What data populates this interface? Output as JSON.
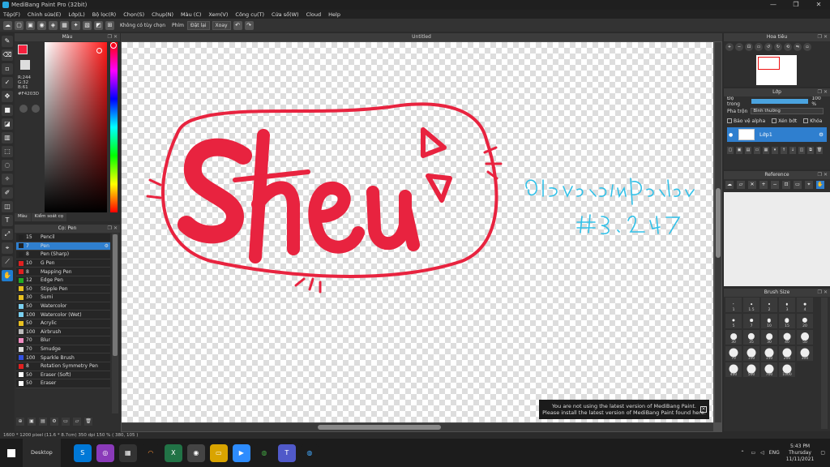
{
  "window": {
    "title": "MediBang Paint Pro (32bit)",
    "min": "—",
    "max": "❐",
    "close": "✕"
  },
  "menu": [
    "Tệp(F)",
    "Chỉnh sửa(E)",
    "Lớp(L)",
    "Bộ lọc(R)",
    "Chọn(S)",
    "Chụp(N)",
    "Màu (C)",
    "Xem(V)",
    "Công cụ(T)",
    "Cửa sổ(W)",
    "Cloud",
    "Help"
  ],
  "toolbar": {
    "aa_label": "Không có tùy chọn",
    "key_label": "Phím",
    "reset_label": "Đặt lại",
    "rotate_label": "Xoay"
  },
  "color_panel": {
    "title": "Màu",
    "r": "R:244",
    "g": "G:32",
    "b": "B:61",
    "hex": "#F4203D",
    "tab1": "Màu",
    "tab2": "Kiểm soát cọ",
    "fg_color": "#f4203d"
  },
  "brush_panel": {
    "title": "Cọ: Pen",
    "items": [
      {
        "size": "15",
        "name": "Pencil",
        "color": "#222222"
      },
      {
        "size": "7",
        "name": "Pen",
        "color": "#222222"
      },
      {
        "size": "8",
        "name": "Pen (Sharp)",
        "color": "#222222"
      },
      {
        "size": "10",
        "name": "G Pen",
        "color": "#e02020"
      },
      {
        "size": "8",
        "name": "Mapping Pen",
        "color": "#e02020"
      },
      {
        "size": "12",
        "name": "Edge Pen",
        "color": "#22aa22"
      },
      {
        "size": "50",
        "name": "Stipple Pen",
        "color": "#e8c020"
      },
      {
        "size": "30",
        "name": "Sumi",
        "color": "#e8c020"
      },
      {
        "size": "50",
        "name": "Watercolor",
        "color": "#7ad0f0"
      },
      {
        "size": "100",
        "name": "Watercolor (Wet)",
        "color": "#7ad0f0"
      },
      {
        "size": "50",
        "name": "Acrylic",
        "color": "#e8c020"
      },
      {
        "size": "100",
        "name": "Airbrush",
        "color": "#bbbbbb"
      },
      {
        "size": "70",
        "name": "Blur",
        "color": "#f08ac0"
      },
      {
        "size": "70",
        "name": "Smudge",
        "color": "#dddddd"
      },
      {
        "size": "100",
        "name": "Sparkle Brush",
        "color": "#3050e0"
      },
      {
        "size": "8",
        "name": "Rotation Symmetry Pen",
        "color": "#e02020"
      },
      {
        "size": "50",
        "name": "Eraser (Soft)",
        "color": "#ffffff"
      },
      {
        "size": "50",
        "name": "Eraser",
        "color": "#ffffff"
      }
    ]
  },
  "document": {
    "tab": "Untitled"
  },
  "notice": {
    "line1": "You are not using the latest version of MediBang Paint.",
    "line2": "Please install the latest version of MediBang Paint found here."
  },
  "status": "1600 * 1200 pixel   (11.6 * 8.7cm)   350 dpi   150 %   ( 380, 105 )",
  "navigator": {
    "title": "Hoa tiêu"
  },
  "layer_panel": {
    "title": "Lớp",
    "opacity_label": "Độ trong",
    "opacity_value": "100 %",
    "opacity": 1.0,
    "blend_label": "Pha trộn",
    "blend_value": "Bình thường",
    "protect_alpha": "Bảo vệ alpha",
    "clipping": "Xén bớt",
    "lock": "Khóa",
    "layer_name": "Lớp1"
  },
  "reference_panel": {
    "title": "Reference"
  },
  "brush_size_panel": {
    "title": "Brush Size",
    "sizes": [
      "1",
      "1.5",
      "2",
      "3",
      "4",
      "5",
      "7",
      "10",
      "15",
      "20",
      "30",
      "35",
      "30",
      "40",
      "50",
      "70",
      "100",
      "150",
      "200",
      "300",
      "400",
      "500",
      "700",
      "1000"
    ]
  },
  "taskbar": {
    "desktop": "Desktop",
    "lang": "ENG",
    "time": "5:43 PM",
    "day": "Thursday",
    "date": "11/11/2021"
  }
}
